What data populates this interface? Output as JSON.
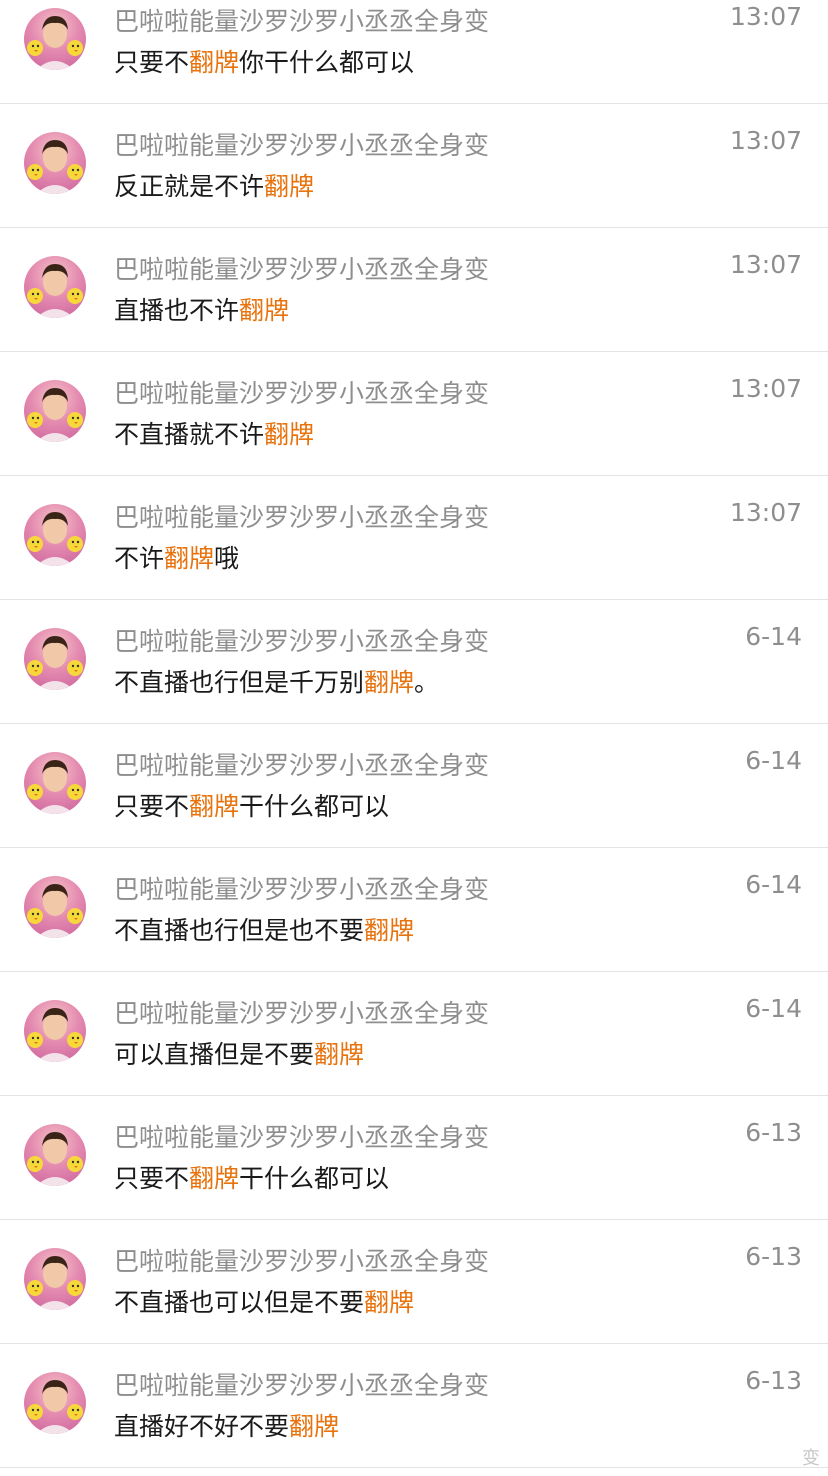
{
  "accent_color": "#e8720c",
  "messages": [
    {
      "sender": "巴啦啦能量沙罗沙罗小丞丞全身变",
      "time": "13:07",
      "before": "只要不",
      "highlight": "翻牌",
      "after": "你干什么都可以"
    },
    {
      "sender": "巴啦啦能量沙罗沙罗小丞丞全身变",
      "time": "13:07",
      "before": "反正就是不许",
      "highlight": "翻牌",
      "after": ""
    },
    {
      "sender": "巴啦啦能量沙罗沙罗小丞丞全身变",
      "time": "13:07",
      "before": "直播也不许",
      "highlight": "翻牌",
      "after": ""
    },
    {
      "sender": "巴啦啦能量沙罗沙罗小丞丞全身变",
      "time": "13:07",
      "before": "不直播就不许",
      "highlight": "翻牌",
      "after": ""
    },
    {
      "sender": "巴啦啦能量沙罗沙罗小丞丞全身变",
      "time": "13:07",
      "before": "不许",
      "highlight": "翻牌",
      "after": "哦"
    },
    {
      "sender": "巴啦啦能量沙罗沙罗小丞丞全身变",
      "time": "6-14",
      "before": "不直播也行但是千万别",
      "highlight": "翻牌",
      "after": "。"
    },
    {
      "sender": "巴啦啦能量沙罗沙罗小丞丞全身变",
      "time": "6-14",
      "before": "只要不",
      "highlight": "翻牌",
      "after": "干什么都可以"
    },
    {
      "sender": "巴啦啦能量沙罗沙罗小丞丞全身变",
      "time": "6-14",
      "before": "不直播也行但是也不要",
      "highlight": "翻牌",
      "after": ""
    },
    {
      "sender": "巴啦啦能量沙罗沙罗小丞丞全身变",
      "time": "6-14",
      "before": "可以直播但是不要",
      "highlight": "翻牌",
      "after": ""
    },
    {
      "sender": "巴啦啦能量沙罗沙罗小丞丞全身变",
      "time": "6-13",
      "before": "只要不",
      "highlight": "翻牌",
      "after": "干什么都可以"
    },
    {
      "sender": "巴啦啦能量沙罗沙罗小丞丞全身变",
      "time": "6-13",
      "before": "不直播也可以但是不要",
      "highlight": "翻牌",
      "after": ""
    },
    {
      "sender": "巴啦啦能量沙罗沙罗小丞丞全身变",
      "time": "6-13",
      "before": "直播好不好不要",
      "highlight": "翻牌",
      "after": ""
    }
  ],
  "watermark": "变"
}
